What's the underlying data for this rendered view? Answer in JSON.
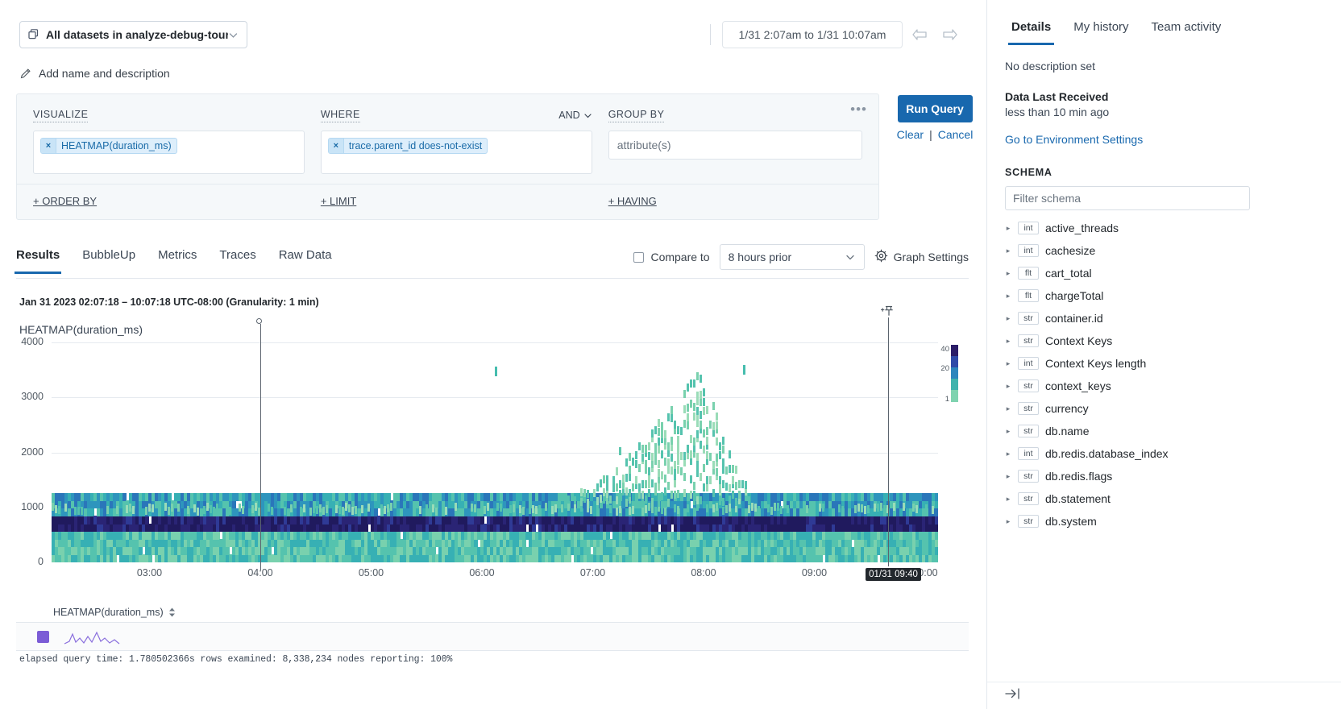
{
  "topbar": {
    "dataset_label": "All datasets in analyze-debug-tour",
    "dataset_icon": "datasets-icon",
    "chevron_icon": "chevron-down-icon",
    "add_name_label": "Add name and description",
    "pencil_icon": "pencil-icon",
    "time_range": "1/31 2:07am to 1/31 10:07am",
    "prev_icon": "arrow-left-icon",
    "next_icon": "arrow-right-icon"
  },
  "query_builder": {
    "visualize_label": "VISUALIZE",
    "visualize_pill": "HEATMAP(duration_ms)",
    "where_label": "WHERE",
    "where_pill": "trace.parent_id does-not-exist",
    "and_label": "AND",
    "group_by_label": "GROUP BY",
    "group_by_placeholder": "attribute(s)",
    "remove_label": "×",
    "more_label": "•••",
    "order_by_label": "+ ORDER BY",
    "limit_label": "+ LIMIT",
    "having_label": "+ HAVING",
    "run_label": "Run Query",
    "clear_label": "Clear",
    "cancel_label": "Cancel",
    "separator": "|",
    "accent": "#1868ae"
  },
  "results": {
    "tabs": [
      {
        "label": "Results",
        "active": true
      },
      {
        "label": "BubbleUp",
        "active": false
      },
      {
        "label": "Metrics",
        "active": false
      },
      {
        "label": "Traces",
        "active": false
      },
      {
        "label": "Raw Data",
        "active": false
      }
    ],
    "compare_label": "Compare to",
    "compare_value": "8 hours prior",
    "compare_checked": false,
    "graph_settings_label": "Graph Settings",
    "gear_icon": "gear-icon"
  },
  "chart_data": {
    "type": "heatmap",
    "title": "HEATMAP(duration_ms)",
    "meta": "Jan 31 2023 02:07:18 – 10:07:18 UTC-08:00 (Granularity: 1 min)",
    "xlabel": "",
    "ylabel": "",
    "ylim": [
      0,
      4000
    ],
    "yticks": [
      0,
      1000,
      2000,
      3000,
      4000
    ],
    "xticks": [
      "03:00",
      "04:00",
      "05:00",
      "06:00",
      "07:00",
      "08:00",
      "09:00",
      "10:00"
    ],
    "grid": true,
    "colorbar": {
      "labels": [
        "40",
        "20",
        "1"
      ],
      "colors": [
        "#2b1d68",
        "#2f4aa8",
        "#2d86bd",
        "#3fb3ad",
        "#7fd3b0"
      ]
    },
    "markers": [
      {
        "label": "",
        "x_time": "04:00",
        "type": "pinned-line-with-dot"
      },
      {
        "label": "01/31 09:40",
        "x_time": "09:40",
        "type": "hover-line-with-pin"
      }
    ],
    "series_legend": {
      "name": "HEATMAP(duration_ms)",
      "swatch_color": "#7b5cd6"
    },
    "notes": "Density heatmap of span duration_ms over 8 hours; bulk of mass under 1000ms with a rising plume peaking near 3200ms around 07:40-08:00"
  },
  "footer": {
    "stats": "elapsed query time: 1.780502366s   rows examined: 8,338,234   nodes reporting: 100%"
  },
  "sidebar": {
    "tabs": [
      {
        "label": "Details",
        "active": true
      },
      {
        "label": "My history",
        "active": false
      },
      {
        "label": "Team activity",
        "active": false
      }
    ],
    "no_description": "No description set",
    "data_last_received_label": "Data Last Received",
    "data_last_received_value": "less than 10 min ago",
    "env_settings_link": "Go to Environment Settings",
    "schema_header": "SCHEMA",
    "filter_placeholder": "Filter schema",
    "filter_value": "",
    "collapse_icon": "collapse-panel-icon",
    "schema_items": [
      {
        "type": "int",
        "name": "active_threads"
      },
      {
        "type": "int",
        "name": "cachesize"
      },
      {
        "type": "flt",
        "name": "cart_total"
      },
      {
        "type": "flt",
        "name": "chargeTotal"
      },
      {
        "type": "str",
        "name": "container.id"
      },
      {
        "type": "str",
        "name": "Context Keys"
      },
      {
        "type": "int",
        "name": "Context Keys length"
      },
      {
        "type": "str",
        "name": "context_keys"
      },
      {
        "type": "str",
        "name": "currency"
      },
      {
        "type": "str",
        "name": "db.name"
      },
      {
        "type": "int",
        "name": "db.redis.database_index"
      },
      {
        "type": "str",
        "name": "db.redis.flags"
      },
      {
        "type": "str",
        "name": "db.statement"
      },
      {
        "type": "str",
        "name": "db.system"
      }
    ]
  }
}
